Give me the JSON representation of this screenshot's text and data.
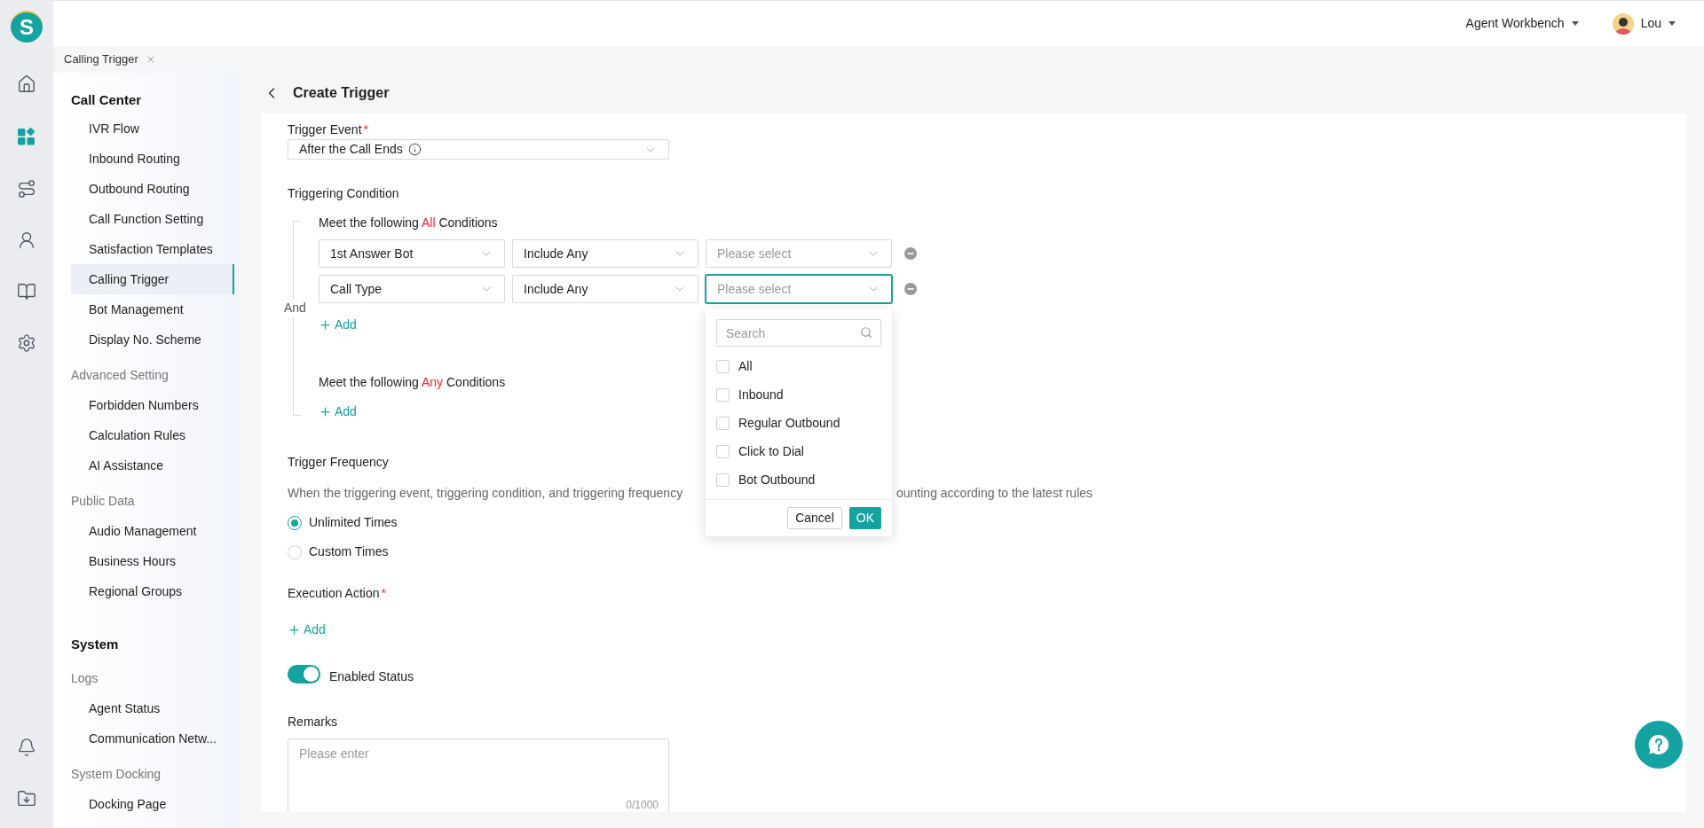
{
  "app": {
    "logo": "S"
  },
  "rail": {
    "top": [
      {
        "kind": "home",
        "selected": false
      },
      {
        "kind": "apps",
        "selected": true
      },
      {
        "kind": "route",
        "selected": false
      },
      {
        "kind": "agent",
        "selected": false
      },
      {
        "kind": "book",
        "selected": false
      },
      {
        "kind": "settings",
        "selected": false
      }
    ],
    "bottom": [
      {
        "kind": "bell"
      },
      {
        "kind": "download"
      }
    ]
  },
  "topbar": {
    "workspace": "Agent Workbench",
    "user": "Lou"
  },
  "tabs": [
    {
      "label": "Calling Trigger",
      "selected": true
    }
  ],
  "sidebar": {
    "sections": [
      {
        "kind": "module",
        "title": "Call Center",
        "items": [
          {
            "label": "IVR Flow",
            "selected": false
          },
          {
            "label": "Inbound Routing",
            "selected": false
          },
          {
            "label": "Outbound Routing",
            "selected": false
          },
          {
            "label": "Call Function Setting",
            "selected": false
          },
          {
            "label": "Satisfaction Templates",
            "selected": false
          },
          {
            "label": "Calling Trigger",
            "selected": true
          },
          {
            "label": "Bot Management",
            "selected": false
          },
          {
            "label": "Display No. Scheme",
            "selected": false
          }
        ]
      },
      {
        "kind": "group",
        "title": "Advanced Setting",
        "items": [
          {
            "label": "Forbidden Numbers",
            "selected": false
          },
          {
            "label": "Calculation Rules",
            "selected": false
          },
          {
            "label": "AI Assistance",
            "selected": false
          }
        ]
      },
      {
        "kind": "group",
        "title": "Public Data",
        "items": [
          {
            "label": "Audio Management",
            "selected": false
          },
          {
            "label": "Business Hours",
            "selected": false
          },
          {
            "label": "Regional Groups",
            "selected": false
          }
        ]
      },
      {
        "kind": "module",
        "title": "System"
      },
      {
        "kind": "group",
        "title": "Logs",
        "items": [
          {
            "label": "Agent Status",
            "selected": false
          },
          {
            "label": "Communication Netw...",
            "selected": false
          }
        ]
      },
      {
        "kind": "group",
        "title": "System Docking",
        "items": [
          {
            "label": "Docking Page",
            "selected": false
          }
        ]
      }
    ]
  },
  "page": {
    "title": "Create Trigger"
  },
  "trigger_event": {
    "label": "Trigger Event",
    "required_mark": "*",
    "value": "After the Call Ends"
  },
  "triggering_condition": {
    "label": "Triggering Condition",
    "joiner": "And",
    "groups": [
      {
        "prefix": "Meet the following",
        "keyword": "All",
        "suffix": "Conditions",
        "add": "Add",
        "rows": [
          {
            "field": "1st Answer Bot",
            "operator": "Include Any",
            "placeholder": "Please select",
            "focused": false
          },
          {
            "field": "Call Type",
            "operator": "Include Any",
            "placeholder": "Please select",
            "focused": true
          }
        ]
      },
      {
        "prefix": "Meet the following",
        "keyword": "Any",
        "suffix": "Conditions",
        "add": "Add"
      }
    ]
  },
  "dropdown": {
    "search_placeholder": "Search",
    "options": [
      {
        "label": "All",
        "checked": false
      },
      {
        "label": "Inbound",
        "checked": false
      },
      {
        "label": "Regular Outbound",
        "checked": false
      },
      {
        "label": "Click to Dial",
        "checked": false
      },
      {
        "label": "Bot Outbound",
        "checked": false
      }
    ],
    "cancel": "Cancel",
    "ok": "OK"
  },
  "trigger_frequency": {
    "label": "Trigger Frequency",
    "description_parts": [
      "When the triggering event, triggering condition, and triggering frequency",
      "ounting according to the latest rules"
    ],
    "options": [
      {
        "label": "Unlimited Times",
        "selected": true
      },
      {
        "label": "Custom Times",
        "selected": false
      }
    ]
  },
  "execution_action": {
    "label": "Execution Action",
    "required_mark": "*",
    "add": "Add"
  },
  "enabled": {
    "label": "Enabled Status",
    "on": true
  },
  "remarks": {
    "label": "Remarks",
    "placeholder": "Please enter",
    "counter": "0/1000"
  }
}
